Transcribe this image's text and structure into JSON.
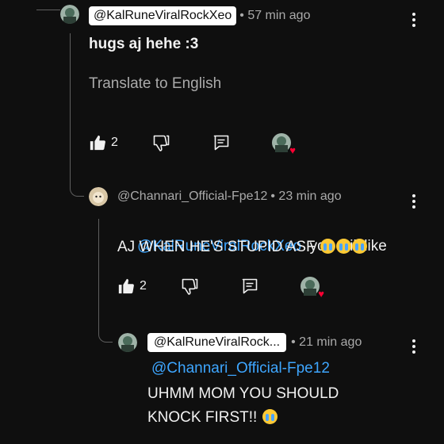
{
  "comments": [
    {
      "handle": "@KalRuneViralRockXeo",
      "time": "• 57 min ago",
      "text": "hugs aj hehe :3",
      "translate": "Translate to English",
      "likes": "2"
    },
    {
      "handle": "@Channari_Official-Fpe12",
      "time": "• 23 min ago",
      "mention": "@KalRuneViralRockXeo",
      "text_line1": "  you still like",
      "text_line2": "AJ WHEN HE'S STUPID ASF",
      "emoji": "crying-face",
      "likes": "2"
    },
    {
      "handle": "@KalRuneViralRock...",
      "time": "• 21 min ago",
      "mention": "@Channari_Official-Fpe12",
      "text_line1": "UHMM MOM YOU SHOULD",
      "text_line2": "KNOCK FIRST!!",
      "emoji": "crying-face"
    }
  ],
  "colors": {
    "background": "#0f0f0f",
    "mention": "#3ea6ff",
    "heart": "#ff0033",
    "meta": "#aaaaaa"
  }
}
